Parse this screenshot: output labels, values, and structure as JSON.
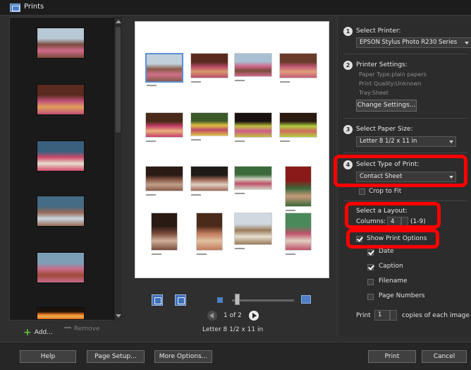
{
  "window": {
    "title": "Prints"
  },
  "filmstrip": {
    "add_label": "Add...",
    "remove_label": "Remove",
    "thumbnails": [
      {
        "name": "film-thumb-1",
        "colors": [
          "#b7c9d6",
          "#7a4a3e",
          "#d16a8a"
        ]
      },
      {
        "name": "film-thumb-2",
        "colors": [
          "#5a2b1e",
          "#c04f7a",
          "#e0a05a"
        ]
      },
      {
        "name": "film-thumb-3",
        "colors": [
          "#3a5f7e",
          "#d14a6a",
          "#e8e0d0"
        ]
      },
      {
        "name": "film-thumb-4",
        "colors": [
          "#456b85",
          "#9a6a56",
          "#c8d6e0"
        ]
      },
      {
        "name": "film-thumb-5",
        "colors": [
          "#7d9fb6",
          "#c86a8a",
          "#a04a3a"
        ]
      },
      {
        "name": "film-thumb-6",
        "colors": [
          "#1f1208",
          "#d66a1e",
          "#f2b04a"
        ]
      }
    ]
  },
  "preview": {
    "page_indicator": "1 of 2",
    "paper_label": "Letter 8 1/2 x 11 in",
    "thumbnails": [
      {
        "colors": [
          "#c2d0dc",
          "#8a5a48",
          "#d0708c"
        ]
      },
      {
        "colors": [
          "#5a2a1e",
          "#b84a6a",
          "#d89a6a"
        ]
      },
      {
        "colors": [
          "#a8c0d2",
          "#d26a90",
          "#7a4a3a"
        ]
      },
      {
        "colors": [
          "#6a3a2a",
          "#c55a7a",
          "#e0a07a"
        ]
      },
      {
        "colors": [
          "#4a2a1a",
          "#c8406a",
          "#e8b07a"
        ]
      },
      {
        "colors": [
          "#3a5a2a",
          "#e0c040",
          "#c04a6a"
        ]
      },
      {
        "colors": [
          "#1a1210",
          "#c0c040",
          "#d05a8a"
        ]
      },
      {
        "colors": [
          "#2a1a10",
          "#b0d040",
          "#d06a5a"
        ]
      },
      {
        "colors": [
          "#2a1a14",
          "#8a5a48",
          "#c0a08a"
        ]
      },
      {
        "colors": [
          "#1e1a18",
          "#a06a58",
          "#e0d0c0"
        ]
      },
      {
        "colors": [
          "#3a6a3a",
          "#d0d0c0",
          "#c0506a"
        ]
      },
      {
        "colors": [
          "#8a1a1a",
          "#3a6a3a",
          "#c89a7a"
        ]
      },
      {
        "colors": [
          "#2a1a14",
          "#7a4a3a",
          "#d0b09a"
        ]
      },
      {
        "colors": [
          "#4a2a1a",
          "#c07a5a",
          "#e0c0a0"
        ]
      },
      {
        "colors": [
          "#d0d8e0",
          "#9a7a5a",
          "#e8e0d0"
        ]
      },
      {
        "colors": [
          "#4a8a5a",
          "#c0506a",
          "#e0d0c0"
        ]
      }
    ]
  },
  "panel": {
    "step1": {
      "num": "1",
      "label": "Select Printer:",
      "value": "EPSON Stylus Photo R230 Series"
    },
    "step2": {
      "num": "2",
      "label": "Printer Settings:",
      "paper_type": "Paper Type:plain papers",
      "print_quality": "Print Quality:Unknown",
      "tray": "Tray:Sheet",
      "button": "Change Settings..."
    },
    "step3": {
      "num": "3",
      "label": "Select Paper Size:",
      "value": "Letter 8 1/2 x 11 in"
    },
    "step4": {
      "num": "4",
      "label": "Select Type of Print:",
      "value": "Contact Sheet",
      "crop_label": "Crop to Fit"
    },
    "layout": {
      "label": "Select a Layout:",
      "columns_label": "Columns:",
      "columns_value": "4",
      "columns_range": "(1-9)",
      "show_options_label": "Show Print Options",
      "options": [
        {
          "label": "Date",
          "checked": true
        },
        {
          "label": "Caption",
          "checked": true
        },
        {
          "label": "Filename",
          "checked": false
        },
        {
          "label": "Page Numbers",
          "checked": false
        }
      ]
    },
    "copies": {
      "prefix": "Print",
      "value": "1",
      "suffix": "copies of each image"
    }
  },
  "bottom": {
    "help": "Help",
    "page_setup": "Page Setup...",
    "more_options": "More Options...",
    "print": "Print",
    "cancel": "Cancel"
  },
  "colors": {
    "highlight": "#ff0000",
    "accent": "#5b8fd4"
  }
}
